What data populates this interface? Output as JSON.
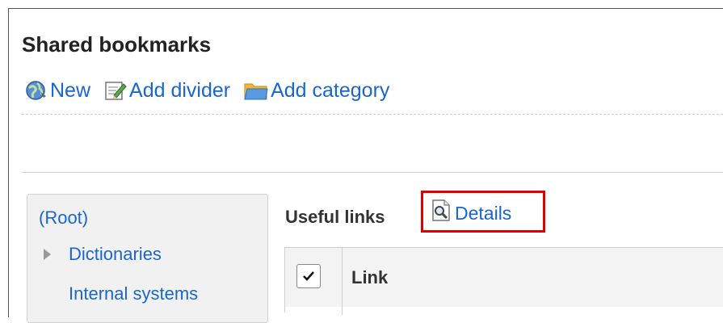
{
  "page": {
    "title": "Shared bookmarks"
  },
  "toolbar": {
    "items": [
      {
        "label": "New",
        "icon": "globe-icon"
      },
      {
        "label": "Add divider",
        "icon": "edit-note-icon"
      },
      {
        "label": "Add category",
        "icon": "folder-icon"
      }
    ]
  },
  "tree": {
    "root": "(Root)",
    "items": [
      {
        "label": "Dictionaries",
        "expandable": true
      },
      {
        "label": "Internal systems",
        "expandable": false
      }
    ]
  },
  "category": {
    "name": "Useful links",
    "details_label": "Details",
    "details_icon": "magnifier-document-icon"
  },
  "table": {
    "columns": [
      "Link"
    ],
    "header_checkbox_checked": true
  },
  "colors": {
    "link": "#1a66cc",
    "highlight": "#e00000"
  }
}
